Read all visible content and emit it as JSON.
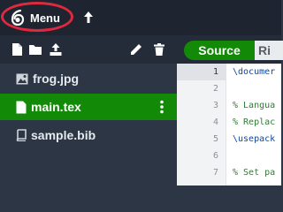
{
  "topbar": {
    "menu_label": "Menu"
  },
  "files": [
    {
      "name": "frog.jpg",
      "icon": "image-icon",
      "selected": false
    },
    {
      "name": "main.tex",
      "icon": "file-icon",
      "selected": true
    },
    {
      "name": "sample.bib",
      "icon": "book-icon",
      "selected": false
    }
  ],
  "editor": {
    "tabs": {
      "source": "Source",
      "rich": "Ri"
    },
    "line_numbers": [
      "1",
      "2",
      "3",
      "4",
      "5",
      "6",
      "7"
    ],
    "lines": [
      "\\documer",
      "",
      "% Langua",
      "% Replac",
      "\\usepack",
      "",
      "% Set pa"
    ]
  },
  "colors": {
    "accent": "#138a07",
    "highlight_ring": "#e0293f",
    "topbar": "#1e2530",
    "sidebar": "#2c3645"
  }
}
